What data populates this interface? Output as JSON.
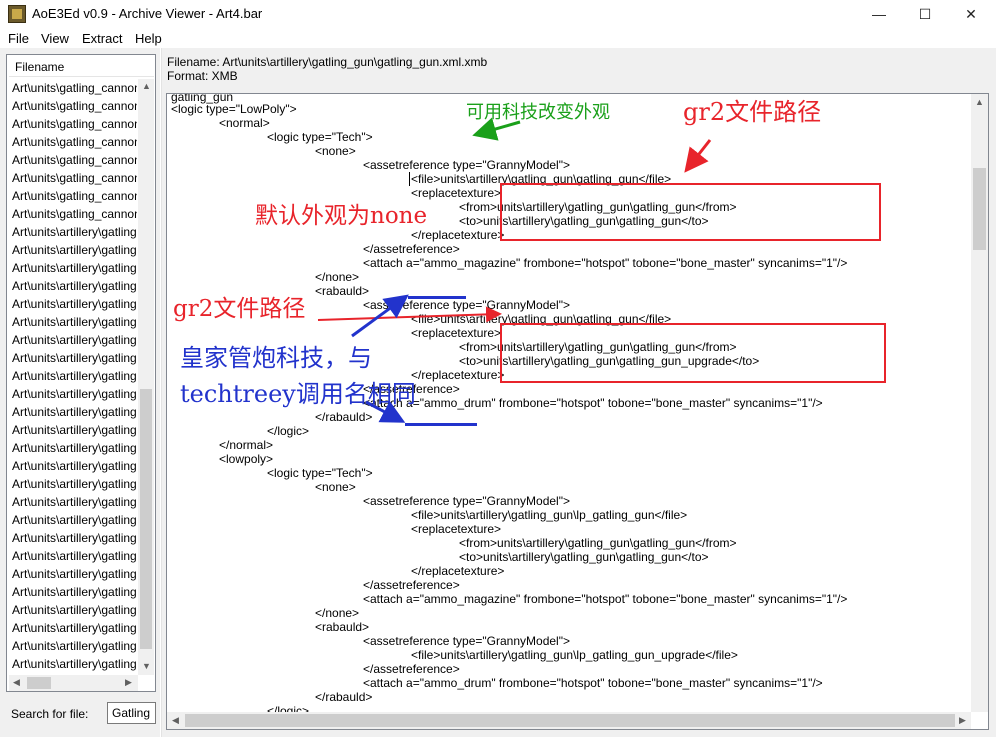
{
  "window": {
    "title": "AoE3Ed v0.9 - Archive Viewer - Art4.bar",
    "min": "—",
    "max": "☐",
    "close": "✕"
  },
  "menu": [
    "File",
    "View",
    "Extract",
    "Help"
  ],
  "filelist": {
    "header": "Filename",
    "rows": [
      "Art\\units\\gatling_cannon",
      "Art\\units\\gatling_cannon",
      "Art\\units\\gatling_cannon",
      "Art\\units\\gatling_cannon",
      "Art\\units\\gatling_cannon",
      "Art\\units\\gatling_cannon",
      "Art\\units\\gatling_cannon",
      "Art\\units\\gatling_cannon",
      "Art\\units\\artillery\\gatling",
      "Art\\units\\artillery\\gatling",
      "Art\\units\\artillery\\gatling",
      "Art\\units\\artillery\\gatling",
      "Art\\units\\artillery\\gatling",
      "Art\\units\\artillery\\gatling",
      "Art\\units\\artillery\\gatling",
      "Art\\units\\artillery\\gatling",
      "Art\\units\\artillery\\gatling",
      "Art\\units\\artillery\\gatling",
      "Art\\units\\artillery\\gatling",
      "Art\\units\\artillery\\gatling",
      "Art\\units\\artillery\\gatling",
      "Art\\units\\artillery\\gatling",
      "Art\\units\\artillery\\gatling",
      "Art\\units\\artillery\\gatling",
      "Art\\units\\artillery\\gatling",
      "Art\\units\\artillery\\gatling",
      "Art\\units\\artillery\\gatling",
      "Art\\units\\artillery\\gatling",
      "Art\\units\\artillery\\gatling",
      "Art\\units\\artillery\\gatling",
      "Art\\units\\artillery\\gatling",
      "Art\\units\\artillery\\gatling",
      "Art\\units\\artillery\\gatling"
    ]
  },
  "search": {
    "label": "Search for file:",
    "value": "Gatling"
  },
  "info": {
    "filename": "Filename: Art\\units\\artillery\\gatling_gun\\gatling_gun.xml.xmb",
    "format": "Format: XMB"
  },
  "code": [
    "gatling_gun",
    "<logic type=\"LowPoly\">",
    "<normal>",
    "<logic type=\"Tech\">",
    "<none>",
    "<assetreference type=\"GrannyModel\">",
    "<file>units\\artillery\\gatling_gun\\gatling_gun</file>",
    "<replacetexture>",
    "<from>units\\artillery\\gatling_gun\\gatling_gun</from>",
    "<to>units\\artillery\\gatling_gun\\gatling_gun</to>",
    "</replacetexture>",
    "</assetreference>",
    "<attach a=\"ammo_magazine\" frombone=\"hotspot\" tobone=\"bone_master\" syncanims=\"1\"/>",
    "</none>",
    "<rabauld>",
    "<assetreference type=\"GrannyModel\">",
    "<file>units\\artillery\\gatling_gun\\gatling_gun</file>",
    "<replacetexture>",
    "<from>units\\artillery\\gatling_gun\\gatling_gun</from>",
    "<to>units\\artillery\\gatling_gun\\gatling_gun_upgrade</to>",
    "</replacetexture>",
    "</assetreference>",
    "<attach a=\"ammo_drum\" frombone=\"hotspot\" tobone=\"bone_master\" syncanims=\"1\"/>",
    "</rabauld>",
    "</logic>",
    "</normal>",
    "<lowpoly>",
    "<logic type=\"Tech\">",
    "<none>",
    "<assetreference type=\"GrannyModel\">",
    "<file>units\\artillery\\gatling_gun\\lp_gatling_gun</file>",
    "<replacetexture>",
    "<from>units\\artillery\\gatling_gun\\gatling_gun</from>",
    "<to>units\\artillery\\gatling_gun\\gatling_gun</to>",
    "</replacetexture>",
    "</assetreference>",
    "<attach a=\"ammo_magazine\" frombone=\"hotspot\" tobone=\"bone_master\" syncanims=\"1\"/>",
    "</none>",
    "<rabauld>",
    "<assetreference type=\"GrannyModel\">",
    "<file>units\\artillery\\gatling_gun\\lp_gatling_gun_upgrade</file>",
    "</assetreference>",
    "<attach a=\"ammo_drum\" frombone=\"hotspot\" tobone=\"bone_master\" syncanims=\"1\"/>",
    "</rabauld>",
    "</logic>"
  ],
  "annotations": {
    "tech_note": "可用科技改变外观",
    "gr2_path_1": "gr2文件路径",
    "default_none": "默认外观为none",
    "gr2_path_2": "gr2文件路径",
    "royal_line1": "皇家管炮科技，与",
    "royal_line2": "techtreey调用名相同"
  },
  "colors": {
    "red": "#e8242b",
    "green": "#1aa01a",
    "blue": "#2233cc"
  }
}
